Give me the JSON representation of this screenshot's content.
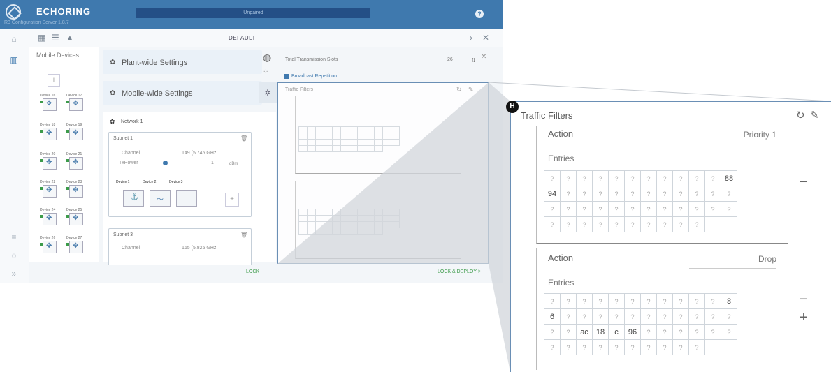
{
  "app": {
    "brand": "ECHORING",
    "subtitle": "R3 Configuration Server 1.8.7",
    "progress_label": "Unpaired",
    "help": "?",
    "layout_name": "DEFAULT"
  },
  "left": {
    "title": "Mobile Devices",
    "add": "+",
    "devices": [
      "Device 16",
      "Device 17",
      "Device 18",
      "Device 19",
      "Device 20",
      "Device 21",
      "Device 22",
      "Device 23",
      "Device 24",
      "Device 25",
      "Device 26",
      "Device 27"
    ]
  },
  "center": {
    "plant": "Plant-wide Settings",
    "mobile": "Mobile-wide Settings",
    "network": "Network 1",
    "subnet1": {
      "title": "Subnet 1",
      "channel_label": "Channel",
      "channel_value": "149 (5.745 GHz",
      "txpower_label": "TxPower",
      "txpower_value": "1",
      "txpower_unit": "dBm",
      "devices": [
        "Device 1",
        "Device 2",
        "Device 3"
      ],
      "add": "+"
    },
    "subnet3": {
      "title": "Subnet 3",
      "channel_label": "Channel",
      "channel_value": "165 (5.825 GHz"
    }
  },
  "right": {
    "slots_label": "Total Transmission Slots",
    "slots_value": "26",
    "broadcast": "Broadcast Repetition",
    "filters_title": "Traffic Filters"
  },
  "bottom": {
    "lock": "LOCK",
    "deploy": "LOCK & DEPLOY >"
  },
  "zoom": {
    "badge": "H",
    "title": "Traffic Filters",
    "f1": {
      "action_label": "Action",
      "action_value": "Priority 1",
      "entries_label": "Entries",
      "rows": [
        [
          "?",
          "?",
          "?",
          "?",
          "?",
          "?",
          "?",
          "?",
          "?",
          "?",
          "?",
          "88"
        ],
        [
          "94",
          "?",
          "?",
          "?",
          "?",
          "?",
          "?",
          "?",
          "?",
          "?",
          "?",
          "?"
        ],
        [
          "?",
          "?",
          "?",
          "?",
          "?",
          "?",
          "?",
          "?",
          "?",
          "?",
          "?",
          "?"
        ],
        [
          "?",
          "?",
          "?",
          "?",
          "?",
          "?",
          "?",
          "?",
          "?",
          "?"
        ]
      ]
    },
    "f2": {
      "action_label": "Action",
      "action_value": "Drop",
      "entries_label": "Entries",
      "rows": [
        [
          "?",
          "?",
          "?",
          "?",
          "?",
          "?",
          "?",
          "?",
          "?",
          "?",
          "?",
          "8"
        ],
        [
          "6",
          "?",
          "?",
          "?",
          "?",
          "?",
          "?",
          "?",
          "?",
          "?",
          "?",
          "?"
        ],
        [
          "?",
          "?",
          "ac",
          "18",
          "c",
          "96",
          "?",
          "?",
          "?",
          "?",
          "?",
          "?"
        ],
        [
          "?",
          "?",
          "?",
          "?",
          "?",
          "?",
          "?",
          "?",
          "?",
          "?"
        ]
      ]
    },
    "minus": "−",
    "plus": "+"
  }
}
